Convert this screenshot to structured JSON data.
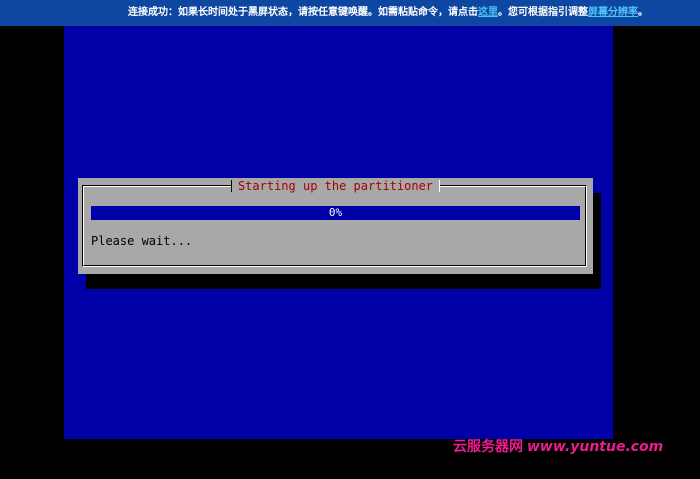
{
  "banner": {
    "text_before": "连接成功：如果长时间处于黑屏状态，请按任意键唤醒。如需粘贴命令，请点击",
    "link1": "这里",
    "text_middle": "。您可根据指引调整",
    "link2": "屏幕分辨率",
    "text_after": "。"
  },
  "dialog": {
    "title": "Starting up the partitioner",
    "progress": 0,
    "progress_text": "0%",
    "message": "Please wait..."
  },
  "watermark": {
    "cn": "云服务器网",
    "url": "www.yuntue.com"
  },
  "colors": {
    "screen": "#0000a8",
    "dialog": "#a8a8a8",
    "title": "#a80000",
    "banner": "#0d47a1",
    "link": "#4fc3f7",
    "watermark": "#e91e8c"
  }
}
